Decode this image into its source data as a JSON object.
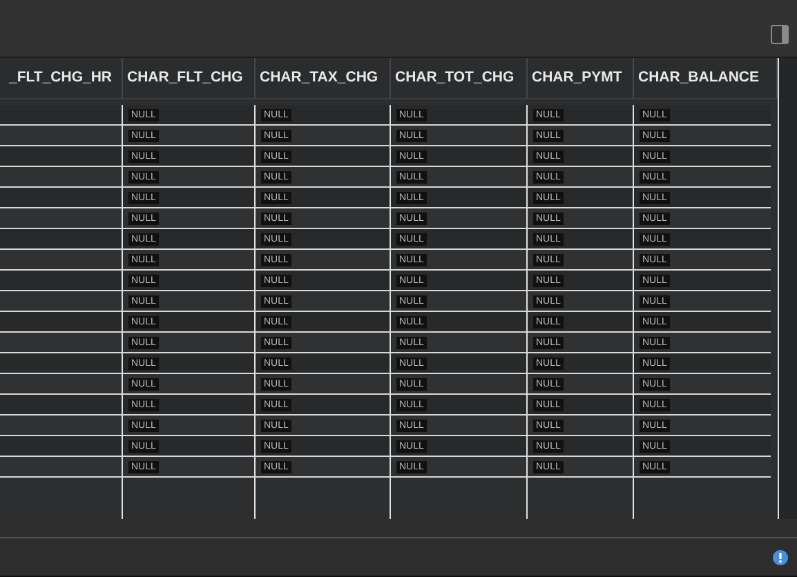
{
  "table": {
    "columns": [
      "_FLT_CHG_HR",
      "CHAR_FLT_CHG",
      "CHAR_TAX_CHG",
      "CHAR_TOT_CHG",
      "CHAR_PYMT",
      "CHAR_BALANCE"
    ],
    "rows": [
      {
        "cells": [
          null,
          "NULL",
          "NULL",
          "NULL",
          "NULL",
          "NULL"
        ]
      },
      {
        "cells": [
          null,
          "NULL",
          "NULL",
          "NULL",
          "NULL",
          "NULL"
        ]
      },
      {
        "cells": [
          null,
          "NULL",
          "NULL",
          "NULL",
          "NULL",
          "NULL"
        ]
      },
      {
        "cells": [
          null,
          "NULL",
          "NULL",
          "NULL",
          "NULL",
          "NULL"
        ]
      },
      {
        "cells": [
          null,
          "NULL",
          "NULL",
          "NULL",
          "NULL",
          "NULL"
        ]
      },
      {
        "cells": [
          null,
          "NULL",
          "NULL",
          "NULL",
          "NULL",
          "NULL"
        ]
      },
      {
        "cells": [
          null,
          "NULL",
          "NULL",
          "NULL",
          "NULL",
          "NULL"
        ]
      },
      {
        "cells": [
          null,
          "NULL",
          "NULL",
          "NULL",
          "NULL",
          "NULL"
        ]
      },
      {
        "cells": [
          null,
          "NULL",
          "NULL",
          "NULL",
          "NULL",
          "NULL"
        ]
      },
      {
        "cells": [
          null,
          "NULL",
          "NULL",
          "NULL",
          "NULL",
          "NULL"
        ]
      },
      {
        "cells": [
          null,
          "NULL",
          "NULL",
          "NULL",
          "NULL",
          "NULL"
        ]
      },
      {
        "cells": [
          null,
          "NULL",
          "NULL",
          "NULL",
          "NULL",
          "NULL"
        ]
      },
      {
        "cells": [
          null,
          "NULL",
          "NULL",
          "NULL",
          "NULL",
          "NULL"
        ]
      },
      {
        "cells": [
          null,
          "NULL",
          "NULL",
          "NULL",
          "NULL",
          "NULL"
        ]
      },
      {
        "cells": [
          null,
          "NULL",
          "NULL",
          "NULL",
          "NULL",
          "NULL"
        ]
      },
      {
        "cells": [
          null,
          "NULL",
          "NULL",
          "NULL",
          "NULL",
          "NULL"
        ]
      },
      {
        "cells": [
          null,
          "NULL",
          "NULL",
          "NULL",
          "NULL",
          "NULL"
        ]
      },
      {
        "cells": [
          null,
          "NULL",
          "NULL",
          "NULL",
          "NULL",
          "NULL"
        ]
      }
    ]
  }
}
